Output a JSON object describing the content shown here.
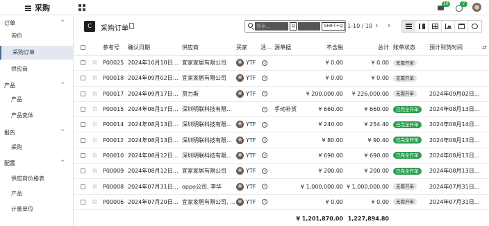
{
  "topbar": {
    "app_title": "采购",
    "notif_count_1": "10",
    "notif_count_2": "7"
  },
  "sidebar": {
    "sections": [
      {
        "label": "订单",
        "items": [
          {
            "label": "询价",
            "active": false
          },
          {
            "label": "采购订单",
            "active": true
          },
          {
            "label": "供应商",
            "active": false
          }
        ]
      },
      {
        "label": "产品",
        "items": [
          {
            "label": "产品",
            "active": false
          },
          {
            "label": "产品变体",
            "active": false
          }
        ]
      },
      {
        "label": "报告",
        "items": [
          {
            "label": "采购",
            "active": false
          }
        ]
      },
      {
        "label": "配置",
        "items": [
          {
            "label": "供应商价格表",
            "active": false
          },
          {
            "label": "产品",
            "active": false
          },
          {
            "label": "计量单位",
            "active": false
          }
        ]
      }
    ]
  },
  "control": {
    "new_label": "C",
    "title": "采购订单",
    "search_placeholder": "搜索...",
    "kbd_key": "Q",
    "kbd_shortcut": "SHIFT+Q",
    "pager": "1-10 / 10"
  },
  "table": {
    "headers": {
      "ref": "参考号",
      "confirm_date": "确认日期",
      "vendor": "供应商",
      "buyer": "买家",
      "activity": "活…",
      "source": "源单据",
      "untaxed": "不含税",
      "total": "总计",
      "bill_status": "账单状态",
      "expected": "预计到货时间"
    },
    "rows": [
      {
        "ref": "P00025",
        "date": "2024年10月10日…",
        "vendor": "宜家家居有限公司",
        "buyer": "YTF",
        "source": "",
        "untaxed": "¥ 0.00",
        "total": "¥ 0.00",
        "status": "无需开单",
        "status_type": "gray",
        "expected": ""
      },
      {
        "ref": "P00018",
        "date": "2024年09月02日…",
        "vendor": "宜家家居有限公司",
        "buyer": "YTF",
        "source": "",
        "untaxed": "¥ 0.00",
        "total": "¥ 0.00",
        "status": "无需开单",
        "status_type": "gray",
        "expected": ""
      },
      {
        "ref": "P00017",
        "date": "2024年09月17日…",
        "vendor": "贾力斯",
        "buyer": "YTF",
        "source": "",
        "untaxed": "¥ 200,000.00",
        "total": "¥ 226,000.00",
        "status": "无需开单",
        "status_type": "gray",
        "expected": "2024年09月02日…"
      },
      {
        "ref": "P00015",
        "date": "2024年08月17日…",
        "vendor": "深圳明联科技有限…",
        "buyer": "",
        "source": "手动补货",
        "untaxed": "¥ 660.00",
        "total": "¥ 660.00",
        "status": "已完全开单",
        "status_type": "green",
        "expected": "2024年08月13日…"
      },
      {
        "ref": "P00014",
        "date": "2024年08月13日…",
        "vendor": "深圳明联科技有限…",
        "buyer": "YTF",
        "source": "",
        "untaxed": "¥ 240.00",
        "total": "¥ 254.40",
        "status": "已完全开单",
        "status_type": "green",
        "expected": "2024年08月14日…"
      },
      {
        "ref": "P00012",
        "date": "2024年08月13日…",
        "vendor": "深圳明联科技有限…",
        "buyer": "YTF",
        "source": "",
        "untaxed": "¥ 80.00",
        "total": "¥ 90.40",
        "status": "已完全开单",
        "status_type": "green",
        "expected": "2024年08月13日…"
      },
      {
        "ref": "P00010",
        "date": "2024年08月12日…",
        "vendor": "深圳明联科技有限…",
        "buyer": "YTF",
        "source": "",
        "untaxed": "¥ 690.00",
        "total": "¥ 690.00",
        "status": "已完全开单",
        "status_type": "green",
        "expected": "2024年08月13日…"
      },
      {
        "ref": "P00009",
        "date": "2024年08月12日…",
        "vendor": "宜家家居有限公司",
        "buyer": "YTF",
        "source": "",
        "untaxed": "¥ 200.00",
        "total": "¥ 200.00",
        "status": "已完全开单",
        "status_type": "green",
        "expected": "2024年08月13日…"
      },
      {
        "ref": "P00008",
        "date": "2024年07月31日…",
        "vendor": "oppo公司, 李华",
        "buyer": "YTF",
        "source": "",
        "untaxed": "¥ 1,000,000.00",
        "total": "¥ 1,000,000.00",
        "status": "无需开单",
        "status_type": "gray",
        "expected": "2024年07月31日…"
      },
      {
        "ref": "P00006",
        "date": "2024年07月20日…",
        "vendor": "宜家家居有限公司, …",
        "buyer": "YTF",
        "source": "",
        "untaxed": "¥ 0.00",
        "total": "¥ 0.00",
        "status": "无需开单",
        "status_type": "gray",
        "expected": "2024年07月31日…"
      }
    ],
    "totals": {
      "untaxed": "¥ 1,201,870.00",
      "total": "¥ 1,227,894.80"
    }
  },
  "colors": {
    "accent": "#4b6a9b",
    "status_green": "#2e9e4f",
    "status_gray": "#e4e4e4"
  }
}
